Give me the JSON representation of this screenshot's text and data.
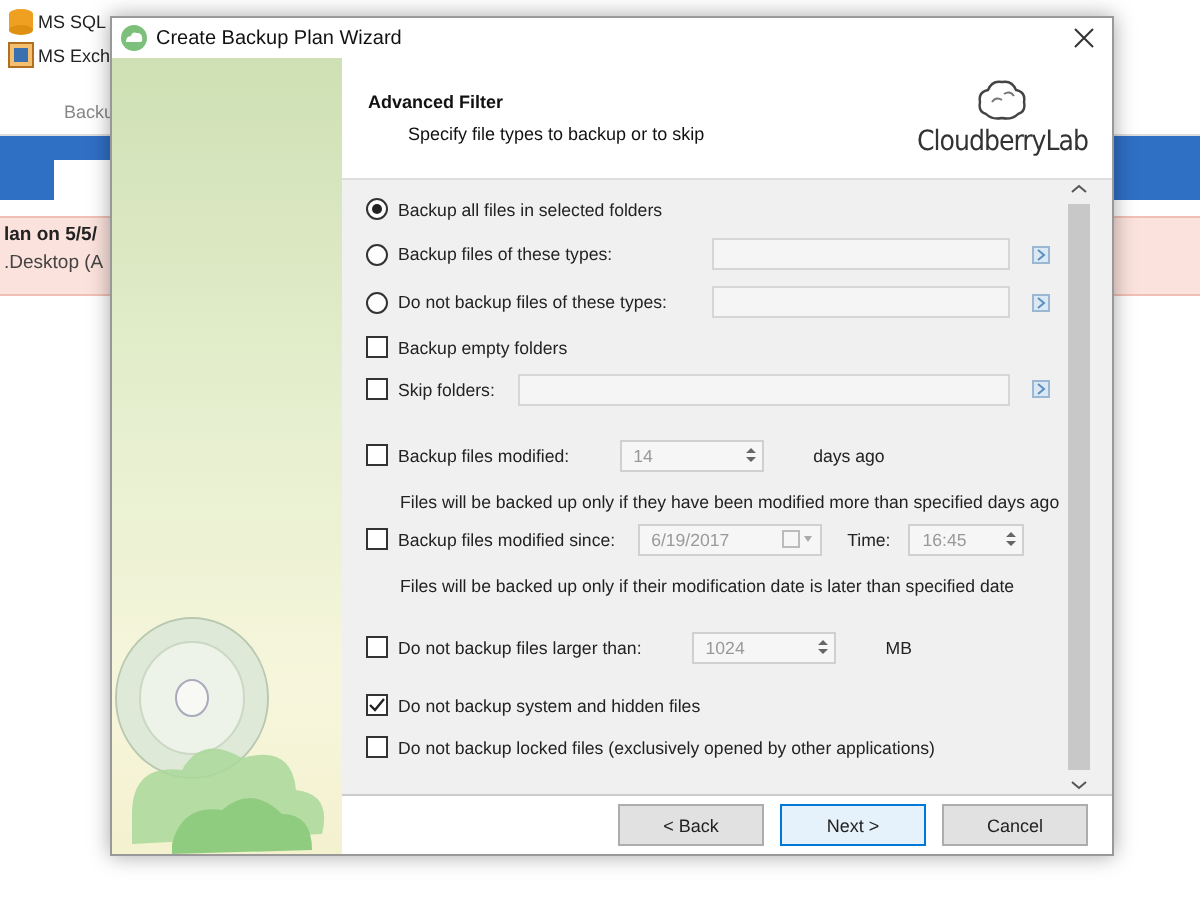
{
  "background_app": {
    "ribbon_items": [
      {
        "label": "MS SQL"
      },
      {
        "label": "MS Exch"
      }
    ],
    "group_label": "Backu",
    "plan_row": {
      "title": "lan on 5/5/",
      "subtitle": ".Desktop (A"
    }
  },
  "dialog": {
    "title": "Create Backup Plan Wizard",
    "header": {
      "title": "Advanced Filter",
      "subtitle": "Specify file types to backup or to skip",
      "logo": "CloudberryLab"
    },
    "options": [
      {
        "kind": "radio",
        "label": "Backup all files in selected folders",
        "selected": true
      },
      {
        "kind": "radio-with-field",
        "label": "Backup files of these types:",
        "selected": false
      },
      {
        "kind": "radio-with-field",
        "label": "Do not backup files of these types:",
        "selected": false
      },
      {
        "kind": "check",
        "label": "Backup empty folders",
        "checked": false
      },
      {
        "kind": "check-with-field",
        "label": "Skip folders:",
        "checked": false
      },
      {
        "kind": "check-with-spin",
        "label": "Backup files modified:",
        "checked": false,
        "value": "14",
        "unit": "days ago"
      },
      {
        "kind": "note",
        "text": "Files will be backed up only if they have been modified more than specified days ago"
      },
      {
        "kind": "check-with-date",
        "label": "Backup files modified since:",
        "checked": false,
        "date": "6/19/2017",
        "time_label": "Time:",
        "time": "16:45"
      },
      {
        "kind": "note",
        "text": "Files will be backed up only if their modification date is later than specified date"
      },
      {
        "kind": "check-with-spin",
        "label": "Do not backup files larger than:",
        "checked": false,
        "value": "1024",
        "unit": "MB"
      },
      {
        "kind": "check",
        "label": "Do not backup system and hidden files",
        "checked": true
      },
      {
        "kind": "check",
        "label": "Do not backup locked files (exclusively opened by other applications)",
        "checked": false
      }
    ],
    "buttons": [
      {
        "label": "< Back",
        "selected": false
      },
      {
        "label": "Next >",
        "selected": true
      },
      {
        "label": "Cancel",
        "selected": false
      }
    ]
  }
}
